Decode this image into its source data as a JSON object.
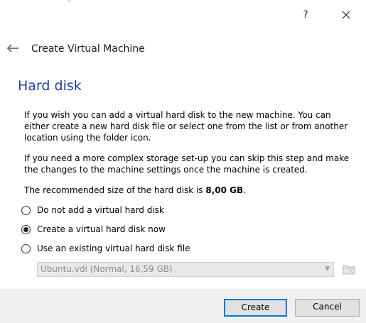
{
  "titlebar": {
    "help_label": "?",
    "close_icon": "close-icon"
  },
  "wizard": {
    "back_icon": "back-arrow-icon",
    "title": "Create Virtual Machine"
  },
  "page": {
    "heading": "Hard disk",
    "paragraph1": "If you wish you can add a virtual hard disk to the new machine. You can either create a new hard disk file or select one from the list or from another location using the folder icon.",
    "paragraph2": "If you need a more complex storage set-up you can skip this step and make the changes to the machine settings once the machine is created.",
    "recommended_prefix": "The recommended size of the hard disk is ",
    "recommended_size": "8,00 GB",
    "recommended_suffix": "."
  },
  "options": [
    {
      "label": "Do not add a virtual hard disk",
      "selected": false
    },
    {
      "label": "Create a virtual hard disk now",
      "selected": true
    },
    {
      "label": "Use an existing virtual hard disk file",
      "selected": false
    }
  ],
  "existing_disk": {
    "value": "Ubuntu.vdi (Normal, 16,59 GB)",
    "enabled": false,
    "folder_icon": "folder-icon"
  },
  "buttons": {
    "create": "Create",
    "cancel": "Cancel"
  },
  "colors": {
    "heading": "#1f3f9c",
    "focus_border": "#0078d7",
    "button_bar": "#f0f0f0"
  }
}
